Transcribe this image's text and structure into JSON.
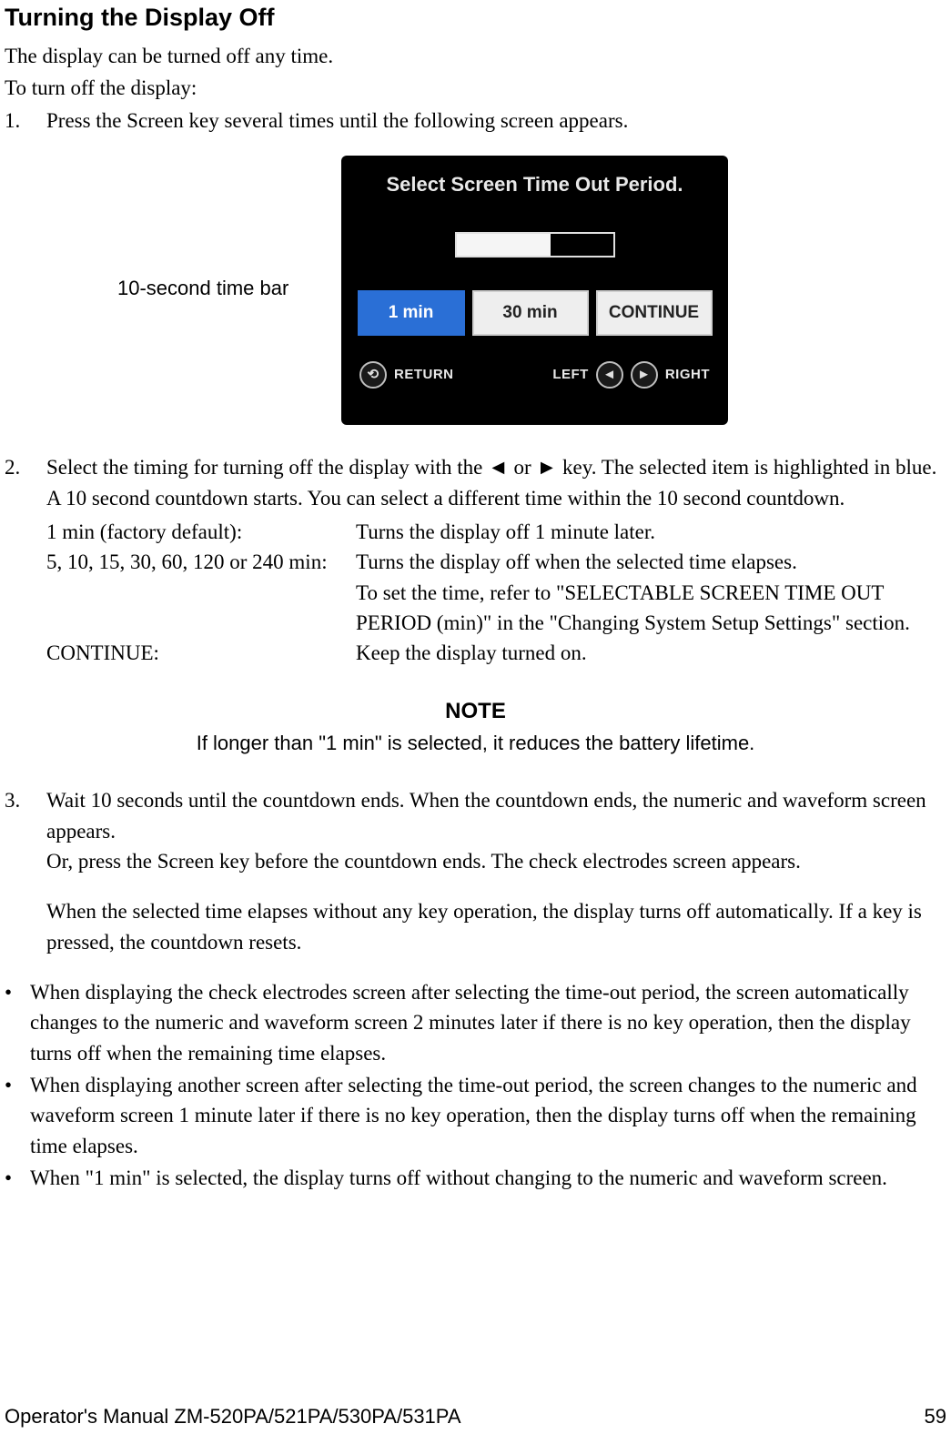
{
  "heading": "Turning the Display Off",
  "intro1": "The display can be turned off any time.",
  "intro2": "To turn off the display:",
  "step1_num": "1.",
  "step1_body": "Press the Screen key several times until the following screen appears.",
  "callout_label": "10-second time bar",
  "device": {
    "title": "Select Screen Time Out Period.",
    "opt1": "1 min",
    "opt2": "30 min",
    "opt3": "CONTINUE",
    "return": "RETURN",
    "left": "LEFT",
    "right": "RIGHT",
    "arrow_left": "◄",
    "arrow_right": "►",
    "return_icon": "⟲"
  },
  "step2_num": "2.",
  "step2_body": "Select the timing for turning off the display with the ◄ or ► key. The selected item is highlighted in blue. A 10 second countdown starts. You can select a different time within the 10 second countdown.",
  "row1_c1": "1 min (factory default):",
  "row1_c2": "Turns the display off 1 minute later.",
  "row2_c1": "5, 10, 15, 30, 60, 120 or 240 min:",
  "row2_c2": "Turns the display off when the selected time elapses.",
  "row3_c2": "To set the time, refer to \"SELECTABLE SCREEN TIME OUT PERIOD (min)\" in the \"Changing System Setup Settings\" section.",
  "row4_c1": "CONTINUE:",
  "row4_c2": "Keep the display turned on.",
  "note_title": "NOTE",
  "note_body": "If longer than \"1 min\" is selected, it reduces the battery lifetime.",
  "step3_num": "3.",
  "step3_body1": "Wait 10 seconds until the countdown ends. When the countdown ends, the numeric and waveform screen appears.",
  "step3_body2": "Or, press the Screen key before the countdown ends. The check electrodes screen appears.",
  "step3_body3": "When the selected time elapses without any key operation, the display turns off automatically. If a key is pressed, the countdown resets.",
  "bullet_dot": "•",
  "bullet1": "When displaying the check electrodes screen after selecting the time-out period, the screen automatically changes to the numeric and waveform screen 2 minutes later if there is no key operation, then the display turns off when the remaining time elapses.",
  "bullet2": "When displaying another screen after selecting the time-out period, the screen changes to the numeric and waveform screen 1 minute later if there is no key operation, then the display turns off when the remaining time elapses.",
  "bullet3": "When \"1 min\" is selected, the display turns off without changing to the numeric and waveform screen.",
  "footer_left": "Operator's Manual  ZM-520PA/521PA/530PA/531PA",
  "footer_right": "59"
}
